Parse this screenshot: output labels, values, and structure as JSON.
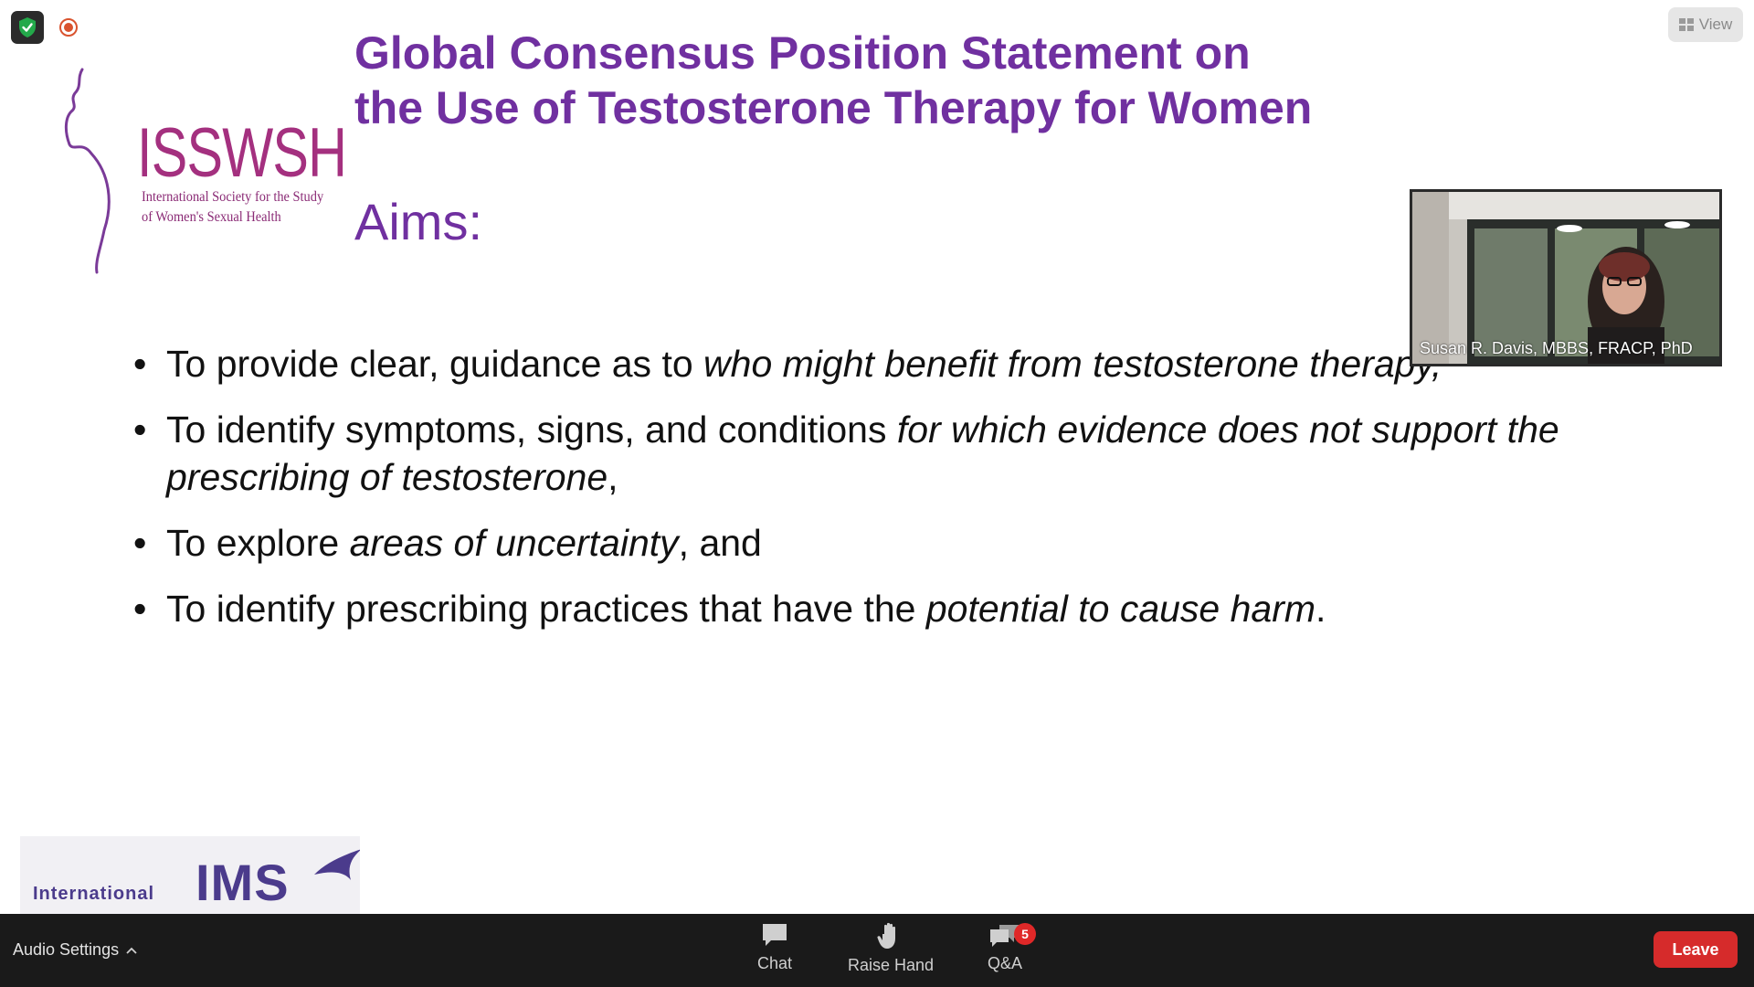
{
  "slide": {
    "title_line1": "Global Consensus Position Statement on",
    "title_line2": "the Use of Testosterone Therapy for Women",
    "aims_heading": "Aims:",
    "bullets": [
      {
        "plain1": "To provide clear, guidance as to ",
        "italic1": "who might benefit from testosterone therapy,",
        "plain2": "",
        "italic2": ""
      },
      {
        "plain1": "To identify symptoms, signs, and conditions ",
        "italic1": "for which evidence does not support the prescribing of testosterone",
        "plain2": ",",
        "italic2": ""
      },
      {
        "plain1": "To explore ",
        "italic1": "areas of uncertainty",
        "plain2": ", and",
        "italic2": ""
      },
      {
        "plain1": "To identify prescribing practices that have the ",
        "italic1": "potential to cause harm",
        "plain2": ".",
        "italic2": ""
      }
    ],
    "bullet_char": "•",
    "isswsh_logo": {
      "wordmark": "ISSWSH",
      "subtitle_line1": "International Society for the Study",
      "subtitle_line2": "of Women's Sexual Health"
    },
    "ims_logo": {
      "intl_text": "International",
      "wordmark": "IMS"
    }
  },
  "video": {
    "participant_name": "Susan R. Davis, MBBS, FRACP, PhD"
  },
  "top": {
    "view_label": "View"
  },
  "toolbar": {
    "audio_settings_label": "Audio Settings",
    "chat_label": "Chat",
    "raise_hand_label": "Raise Hand",
    "qa_label": "Q&A",
    "qa_badge_count": "5",
    "leave_label": "Leave"
  },
  "colors": {
    "title_purple": "#7030a0",
    "logo_magenta": "#a4307f",
    "ims_purple": "#4b3b8c",
    "leave_red": "#d62b2b",
    "toolbar_bg": "#1a1a1a"
  }
}
